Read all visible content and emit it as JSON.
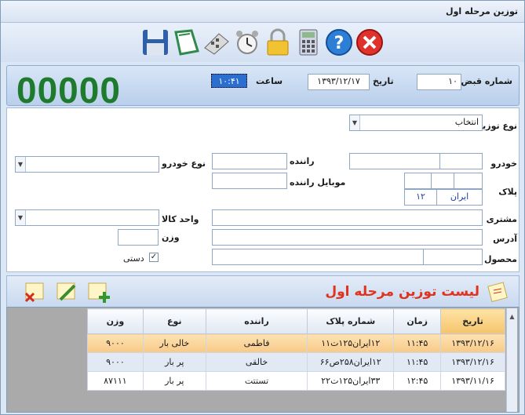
{
  "window": {
    "title": "توزین مرحله اول"
  },
  "toolbar": {
    "icons": [
      "save-icon",
      "new-document-icon",
      "calculator-icon",
      "alarm-clock-icon",
      "lock-icon",
      "calculator-device-icon",
      "help-icon",
      "close-icon"
    ]
  },
  "header": {
    "counter": "00000",
    "receipt_label": "شماره قبض",
    "receipt_value": "۱۰",
    "date_label": "تاریخ",
    "date_value": "۱۳۹۳/۱۲/۱۷",
    "time_label": "ساعت",
    "time_value": "۱۰:۴۱"
  },
  "form": {
    "weighing_type_label": "نوع توزین",
    "weighing_type_value": "انتخاب",
    "vehicle_label": "خودرو",
    "vehicle_type_label": "نوع خودرو",
    "driver_label": "راننده",
    "driver_mobile_label": "موبایل راننده",
    "plate_label": "پلاک",
    "plate_country": "ایران",
    "plate_code": "۱۲",
    "customer_label": "مشتری",
    "unit_label": "واحد کالا",
    "address_label": "آدرس",
    "weight_label": "وزن",
    "product_label": "محصول",
    "manual_label": "دستی"
  },
  "grid": {
    "title": "لیست توزین مرحله اول",
    "columns": [
      "تاریخ",
      "زمان",
      "شماره پلاک",
      "راننده",
      "نوع",
      "وزن"
    ],
    "rows": [
      [
        "۱۳۹۳/۱۲/۱۶",
        "۱۱:۴۵",
        "۱۲ایران۱۲۵ت۱۱",
        "فاطمی",
        "خالی بار",
        "۹۰۰۰"
      ],
      [
        "۱۳۹۳/۱۲/۱۶",
        "۱۱:۴۵",
        "۱۲ایران۲۵۸ص۶۶",
        "خالقی",
        "پر بار",
        "۹۰۰۰"
      ],
      [
        "۱۳۹۳/۱۱/۱۶",
        "۱۲:۴۵",
        "۳۳ایران۱۲۵ت۲۲",
        "تستتت",
        "پر بار",
        "۸۷۱۱۱"
      ]
    ]
  },
  "colors": {
    "counter": "#1e7a2c",
    "grid_title": "#e0321c",
    "selected_row": "#f8c987"
  }
}
